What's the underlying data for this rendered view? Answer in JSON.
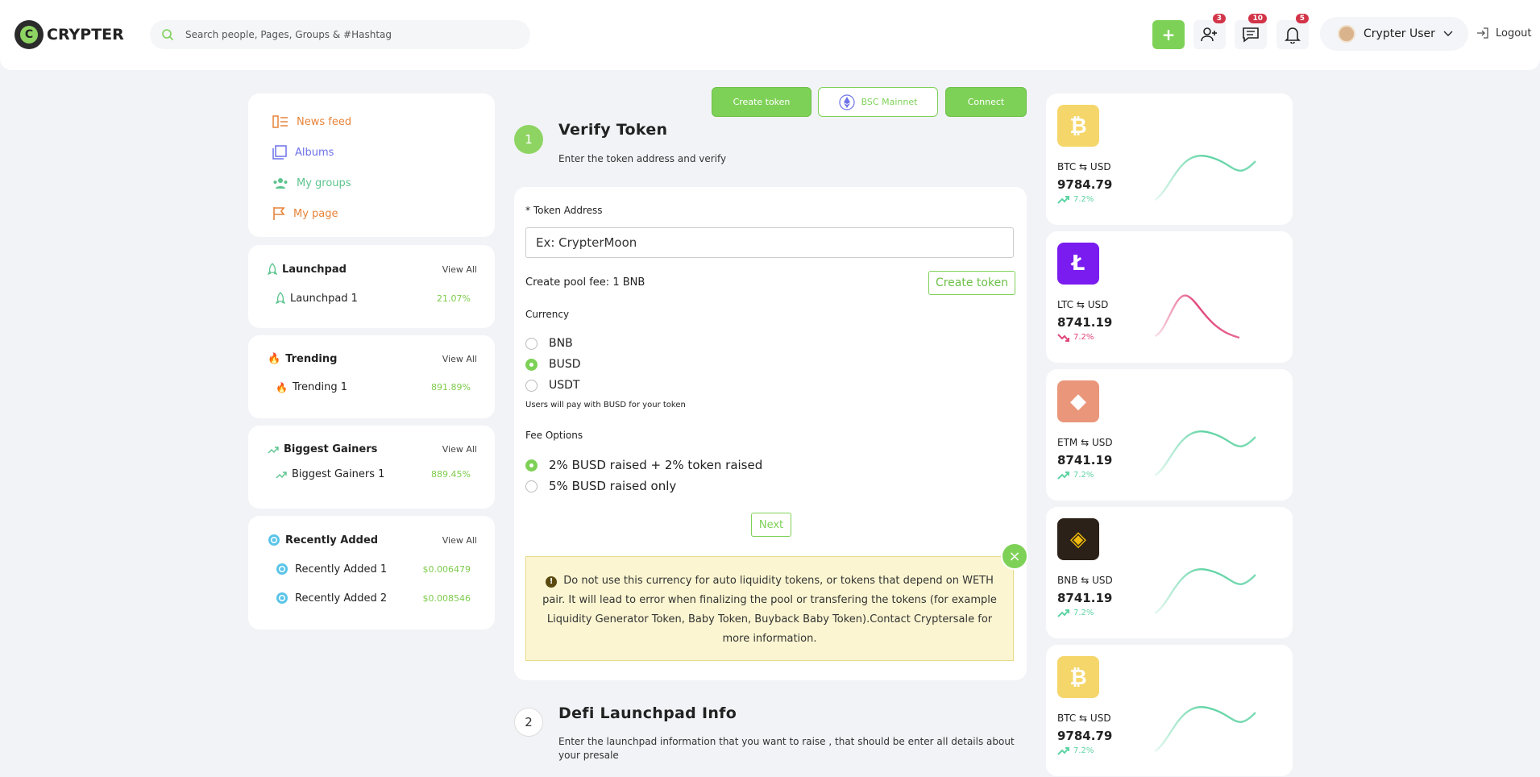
{
  "header": {
    "logo_text": "CRYPTER",
    "logo_letter": "C",
    "search_placeholder": "Search people, Pages, Groups & #Hashtag",
    "add_label": "+",
    "friend_badge": "3",
    "message_badge": "10",
    "notif_badge": "5",
    "user_name": "Crypter User",
    "logout_label": "Logout"
  },
  "sidebar": {
    "nav": [
      {
        "label": "News feed",
        "color": "#e7843a"
      },
      {
        "label": "Albums",
        "color": "#6c72e8"
      },
      {
        "label": "My groups",
        "color": "#5cc48e"
      },
      {
        "label": "My page",
        "color": "#e7843a"
      }
    ],
    "launchpad": {
      "title": "Launchpad",
      "view_all": "View All",
      "items": [
        {
          "name": "Launchpad 1",
          "value": "21.07%"
        }
      ]
    },
    "trending": {
      "title": "Trending",
      "view_all": "View All",
      "items": [
        {
          "name": "Trending 1",
          "value": "891.89%"
        }
      ]
    },
    "gainers": {
      "title": "Biggest Gainers",
      "view_all": "View All",
      "items": [
        {
          "name": "Biggest Gainers 1",
          "value": "889.45%"
        }
      ]
    },
    "recent": {
      "title": "Recently Added",
      "view_all": "View All",
      "items": [
        {
          "name": "Recently Added 1",
          "value": "$0.006479"
        },
        {
          "name": "Recently Added 2",
          "value": "$0.008546"
        }
      ]
    }
  },
  "toolbar": {
    "create_token": "Create token",
    "network": "BSC Mainnet",
    "connect": "Connect"
  },
  "step1": {
    "number": "1",
    "title": "Verify Token",
    "subtitle": "Enter the token address and verify"
  },
  "form": {
    "token_label": "* Token Address",
    "token_placeholder": "Ex: CrypterMoon",
    "pool_fee": "Create pool fee: 1 BNB",
    "create_token_btn": "Create token",
    "currency_label": "Currency",
    "currencies": [
      "BNB",
      "BUSD",
      "USDT"
    ],
    "selected_currency": "BUSD",
    "currency_note": "Users will pay with BUSD for your token",
    "fee_label": "Fee Options",
    "fee_options": [
      "2% BUSD raised + 2% token raised",
      "5% BUSD raised only"
    ],
    "next_label": "Next",
    "warning_icon": "!",
    "warning": "Do not use this currency for auto liquidity tokens, or tokens that depend on WETH pair. It will lead to error when finalizing the pool or transfering the tokens (for example Liquidity Generator Token, Baby Token, Buyback Baby Token).Contact Cryptersale for more information.",
    "close_label": "×"
  },
  "step2": {
    "number": "2",
    "title": "Defi Launchpad Info",
    "subtitle": "Enter the launchpad information that you want to raise , that should be enter all details about your presale"
  },
  "coins": [
    {
      "symbol": "BTC",
      "pair": "BTC ⇆ USD",
      "price": "9784.79",
      "change": "7.2%",
      "up": true,
      "bg": "#f5d66b",
      "fg": "#fff",
      "glyph": "₿"
    },
    {
      "symbol": "LTC",
      "pair": "LTC ⇆ USD",
      "price": "8741.19",
      "change": "7.2%",
      "up": false,
      "bg": "#7a1cf0",
      "fg": "#fff",
      "glyph": "Ł"
    },
    {
      "symbol": "ETM",
      "pair": "ETM ⇆ USD",
      "price": "8741.19",
      "change": "7.2%",
      "up": true,
      "bg": "#e9967a",
      "fg": "#fff",
      "glyph": "◆"
    },
    {
      "symbol": "BNB",
      "pair": "BNB ⇆ USD",
      "price": "8741.19",
      "change": "7.2%",
      "up": true,
      "bg": "#2b2118",
      "fg": "#f0b90b",
      "glyph": "◈"
    },
    {
      "symbol": "BTC",
      "pair": "BTC ⇆ USD",
      "price": "9784.79",
      "change": "7.2%",
      "up": true,
      "bg": "#f5d66b",
      "fg": "#fff",
      "glyph": "₿"
    }
  ]
}
